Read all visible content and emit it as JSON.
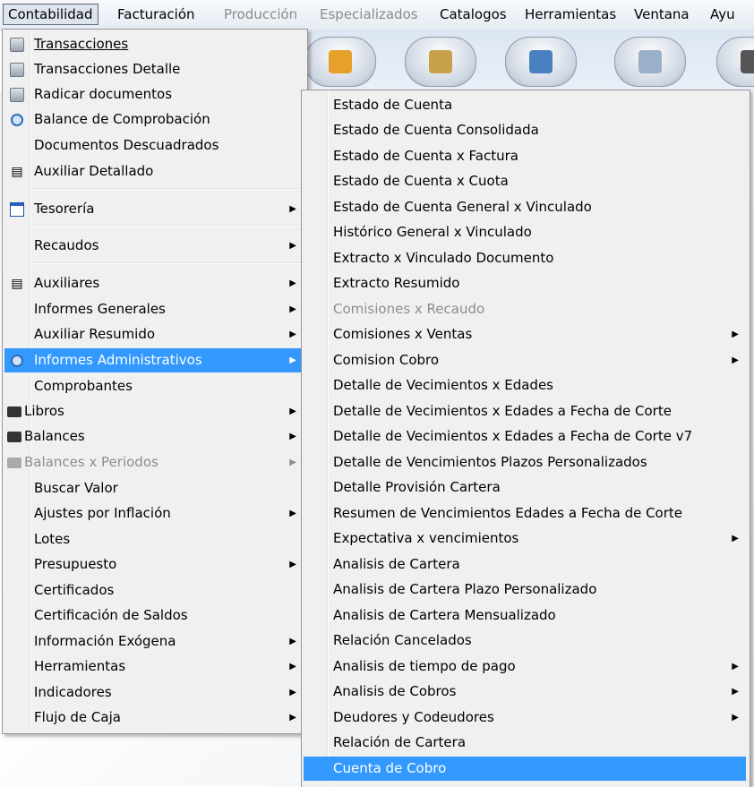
{
  "menubar": {
    "items": [
      {
        "label": "Contabilidad",
        "state": "active"
      },
      {
        "label": "Facturación",
        "state": "normal"
      },
      {
        "label": "Producción",
        "state": "disabled"
      },
      {
        "label": "Especializados",
        "state": "disabled"
      },
      {
        "label": "Catalogos",
        "state": "normal"
      },
      {
        "label": "Herramientas",
        "state": "normal"
      },
      {
        "label": "Ventana",
        "state": "normal"
      },
      {
        "label": "Ayu",
        "state": "normal"
      }
    ]
  },
  "toolbar": {
    "buttons": [
      {
        "icon": "truck-icon",
        "color": "#e7a02a"
      },
      {
        "icon": "clipboard-add-icon",
        "color": "#c9a04a"
      },
      {
        "icon": "id-card-icon",
        "color": "#4a7fc0"
      },
      {
        "icon": "document-transfer-icon",
        "color": "#9ab0c8"
      },
      {
        "icon": "calculator-icon",
        "color": "#555555"
      }
    ]
  },
  "main_menu": {
    "items": [
      {
        "label": "Transacciones",
        "icon": "document-icon",
        "has_submenu": false
      },
      {
        "label": "Transacciones Detalle",
        "icon": "document-icon",
        "has_submenu": false
      },
      {
        "label": "Radicar documentos",
        "icon": "document-icon",
        "has_submenu": false
      },
      {
        "label": "Balance de Comprobación",
        "icon": "magnifier-icon",
        "has_submenu": false
      },
      {
        "label": "Documentos Descuadrados",
        "icon": "",
        "has_submenu": false
      },
      {
        "label": "Auxiliar Detallado",
        "icon": "ledger-icon",
        "has_submenu": false
      },
      {
        "label": "Tesorería",
        "icon": "treasury-icon",
        "has_submenu": true
      },
      {
        "label": "Recaudos",
        "icon": "",
        "has_submenu": true
      },
      {
        "label": "Auxiliares",
        "icon": "ledger-icon",
        "has_submenu": true
      },
      {
        "label": "Informes Generales",
        "icon": "",
        "has_submenu": true
      },
      {
        "label": "Auxiliar Resumido",
        "icon": "",
        "has_submenu": true
      },
      {
        "label": "Informes Administrativos",
        "icon": "magnifier-icon",
        "has_submenu": true,
        "highlighted": true
      },
      {
        "label": "Comprobantes",
        "icon": "",
        "has_submenu": false
      },
      {
        "label": "Libros",
        "icon": "printer-icon",
        "has_submenu": true
      },
      {
        "label": "Balances",
        "icon": "printer-icon",
        "has_submenu": true
      },
      {
        "label": "Balances x Periodos",
        "icon": "printer-icon",
        "has_submenu": true,
        "disabled": true
      },
      {
        "label": "Buscar Valor",
        "icon": "",
        "has_submenu": false
      },
      {
        "label": "Ajustes por Inflación",
        "icon": "",
        "has_submenu": true
      },
      {
        "label": "Lotes",
        "icon": "",
        "has_submenu": false
      },
      {
        "label": "Presupuesto",
        "icon": "",
        "has_submenu": true
      },
      {
        "label": "Certificados",
        "icon": "",
        "has_submenu": false
      },
      {
        "label": "Certificación de Saldos",
        "icon": "",
        "has_submenu": false
      },
      {
        "label": "Información Exógena",
        "icon": "",
        "has_submenu": true
      },
      {
        "label": "Herramientas",
        "icon": "",
        "has_submenu": true
      },
      {
        "label": "Indicadores",
        "icon": "",
        "has_submenu": true
      },
      {
        "label": "Flujo de Caja",
        "icon": "",
        "has_submenu": true
      }
    ]
  },
  "sub_menu": {
    "items": [
      {
        "label": "Estado de Cuenta",
        "has_submenu": false
      },
      {
        "label": "Estado de Cuenta Consolidada",
        "has_submenu": false
      },
      {
        "label": "Estado de Cuenta x Factura",
        "has_submenu": false
      },
      {
        "label": "Estado de Cuenta x Cuota",
        "has_submenu": false
      },
      {
        "label": "Estado de Cuenta General x Vinculado",
        "has_submenu": false
      },
      {
        "label": "Histórico General x Vinculado",
        "has_submenu": false
      },
      {
        "label": "Extracto x Vinculado Documento",
        "has_submenu": false
      },
      {
        "label": "Extracto Resumido",
        "has_submenu": false
      },
      {
        "label": "Comisiones x Recaudo",
        "has_submenu": false,
        "disabled": true
      },
      {
        "label": "Comisiones x Ventas",
        "has_submenu": true
      },
      {
        "label": "Comision Cobro",
        "has_submenu": true
      },
      {
        "label": "Detalle de Vecimientos x Edades",
        "has_submenu": false
      },
      {
        "label": "Detalle de Vecimientos x Edades a Fecha de Corte",
        "has_submenu": false
      },
      {
        "label": "Detalle de Vecimientos x Edades a Fecha de Corte v7",
        "has_submenu": false
      },
      {
        "label": "Detalle de Vencimientos Plazos Personalizados",
        "has_submenu": false
      },
      {
        "label": "Detalle Provisión Cartera",
        "has_submenu": false
      },
      {
        "label": "Resumen de Vencimientos Edades a Fecha de Corte",
        "has_submenu": false
      },
      {
        "label": "Expectativa x vencimientos",
        "has_submenu": true
      },
      {
        "label": "Analisis de Cartera",
        "has_submenu": false
      },
      {
        "label": "Analisis de Cartera Plazo Personalizado",
        "has_submenu": false
      },
      {
        "label": "Analisis de Cartera Mensualizado",
        "has_submenu": false
      },
      {
        "label": "Relación Cancelados",
        "has_submenu": false
      },
      {
        "label": "Analisis de tiempo de pago",
        "has_submenu": true
      },
      {
        "label": "Analisis de Cobros",
        "has_submenu": true
      },
      {
        "label": "Deudores y Codeudores",
        "has_submenu": true
      },
      {
        "label": "Relación de Cartera",
        "has_submenu": false
      },
      {
        "label": "Cuenta de Cobro",
        "has_submenu": false,
        "highlighted": true
      }
    ]
  },
  "colors": {
    "highlight": "#3399ff",
    "menu_bg": "#f0f0f0",
    "disabled_text": "#8d8d8d"
  }
}
